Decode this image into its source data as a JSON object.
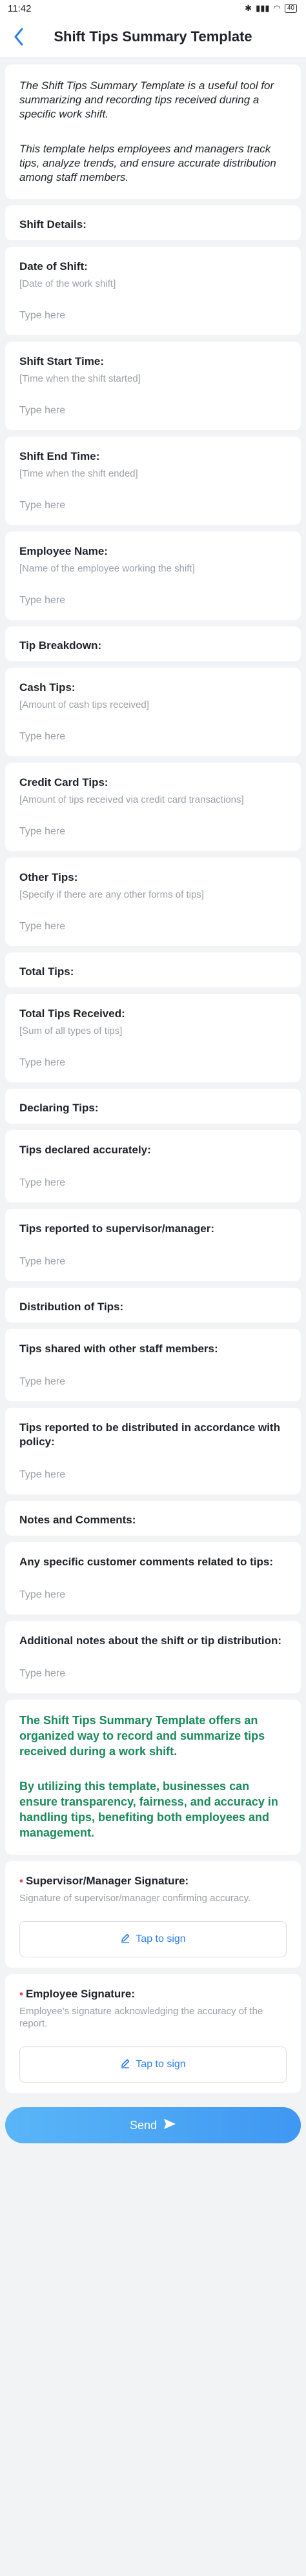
{
  "status_bar": {
    "time": "11:42",
    "battery": "40"
  },
  "header": {
    "title": "Shift Tips Summary Template"
  },
  "intro": [
    "The Shift Tips Summary Template is a useful tool for summarizing and recording tips received during a specific work shift.",
    "This template helps employees and managers track tips, analyze trends, and ensure accurate distribution among staff members."
  ],
  "placeholder": "Type here",
  "blocks": [
    {
      "type": "section",
      "title": "Shift Details:"
    },
    {
      "type": "field",
      "label": "Date of Shift:",
      "hint": "[Date of the work shift]"
    },
    {
      "type": "field",
      "label": "Shift Start Time:",
      "hint": "[Time when the shift started]"
    },
    {
      "type": "field",
      "label": "Shift End Time:",
      "hint": "[Time when the shift ended]"
    },
    {
      "type": "field",
      "label": "Employee Name:",
      "hint": "[Name of the employee working the shift]"
    },
    {
      "type": "section",
      "title": "Tip Breakdown:"
    },
    {
      "type": "field",
      "label": "Cash Tips:",
      "hint": "[Amount of cash tips received]"
    },
    {
      "type": "field",
      "label": "Credit Card Tips:",
      "hint": "[Amount of tips received via credit card transactions]"
    },
    {
      "type": "field",
      "label": "Other Tips:",
      "hint": "[Specify if there are any other forms of tips]"
    },
    {
      "type": "section",
      "title": "Total Tips:"
    },
    {
      "type": "field",
      "label": "Total Tips Received:",
      "hint": "[Sum of all types of tips]"
    },
    {
      "type": "section",
      "title": "Declaring Tips:"
    },
    {
      "type": "field",
      "label": "Tips declared accurately:",
      "hint": ""
    },
    {
      "type": "field",
      "label": "Tips reported to supervisor/manager:",
      "hint": ""
    },
    {
      "type": "section",
      "title": "Distribution of Tips:"
    },
    {
      "type": "field",
      "label": "Tips shared with other staff members:",
      "hint": ""
    },
    {
      "type": "field",
      "label": "Tips reported to be distributed in accordance with policy:",
      "hint": ""
    },
    {
      "type": "section",
      "title": "Notes and Comments:"
    },
    {
      "type": "field",
      "label": "Any specific customer comments related to tips:",
      "hint": ""
    },
    {
      "type": "field",
      "label": "Additional notes about the shift or tip distribution:",
      "hint": ""
    }
  ],
  "closing": [
    "The Shift Tips Summary Template offers an organized way to record and summarize tips received during a work shift.",
    "By utilizing this template, businesses can ensure transparency, fairness, and accuracy in handling tips, benefiting both employees and management."
  ],
  "signatures": [
    {
      "label": "Supervisor/Manager Signature:",
      "hint": "Signature of supervisor/manager confirming accuracy.",
      "button": "Tap to sign"
    },
    {
      "label": "Employee Signature:",
      "hint": "Employee's signature acknowledging the accuracy of the report.",
      "button": "Tap to sign"
    }
  ],
  "send": {
    "label": "Send"
  },
  "colors": {
    "accent": "#2b7de9",
    "green": "#1a8a5a",
    "required": "#e54b4b",
    "background": "#f2f3f5"
  }
}
